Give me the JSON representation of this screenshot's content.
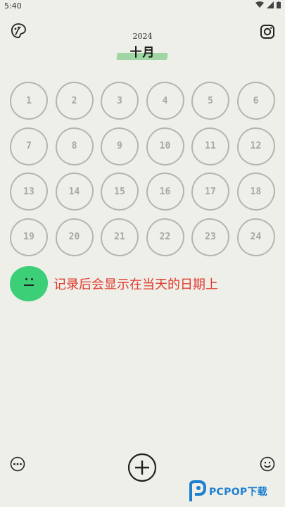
{
  "status_bar": {
    "time": "5:40"
  },
  "header": {
    "year": "2024",
    "month": "十月"
  },
  "days": [
    "1",
    "2",
    "3",
    "4",
    "5",
    "6",
    "7",
    "8",
    "9",
    "10",
    "11",
    "12",
    "13",
    "14",
    "15",
    "16",
    "17",
    "18",
    "19",
    "20",
    "21",
    "22",
    "23",
    "24"
  ],
  "hint": {
    "text": "记录后会显示在当天的日期上"
  },
  "icons": {
    "top_left": "palette-leaf-icon",
    "top_right": "instagram-icon",
    "bottom_left": "more-options-icon",
    "bottom_right": "smiley-icon",
    "add": "add-icon"
  },
  "colors": {
    "background": "#efefe9",
    "accent_green": "#3dcf78",
    "hint_red": "#e0392d",
    "highlight": "#9fd6a3"
  },
  "watermark": {
    "text": "PCPOP下载"
  }
}
